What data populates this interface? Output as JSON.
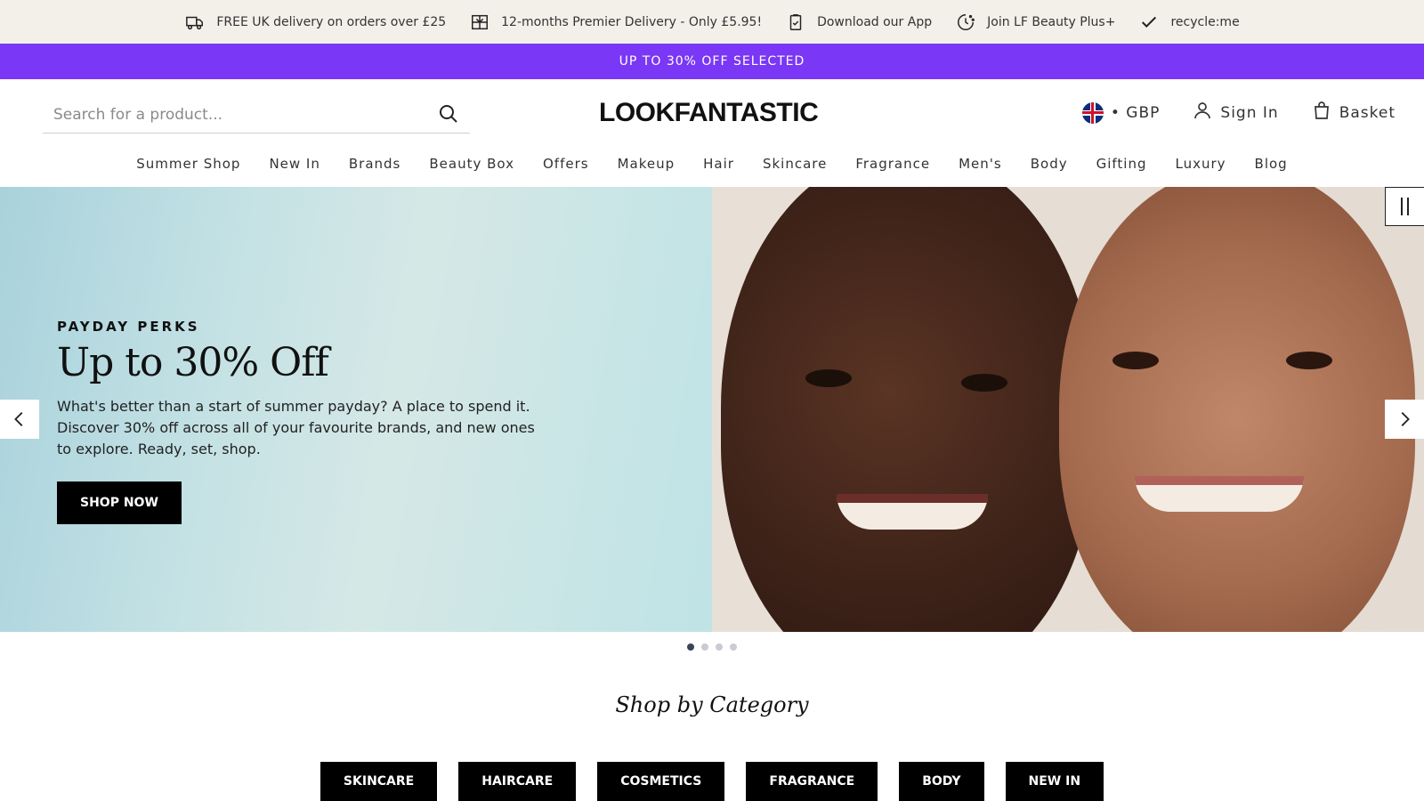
{
  "benefits": [
    {
      "label": "FREE UK delivery on orders over £25",
      "icon": "truck-icon"
    },
    {
      "label": "12-months Premier Delivery - Only £5.95!",
      "icon": "gift-icon"
    },
    {
      "label": "Download our App",
      "icon": "phone-icon"
    },
    {
      "label": "Join LF Beauty Plus+",
      "icon": "loyalty-icon"
    },
    {
      "label": "recycle:me",
      "icon": "check-icon"
    }
  ],
  "promo": {
    "text": "UP TO 30% OFF SELECTED",
    "color": "#7a37f5"
  },
  "search": {
    "placeholder": "Search for a product..."
  },
  "logo": "LOOKFANTASTIC",
  "header": {
    "currency": "• GBP",
    "sign_in": "Sign In",
    "basket": "Basket"
  },
  "nav": [
    "Summer Shop",
    "New In",
    "Brands",
    "Beauty Box",
    "Offers",
    "Makeup",
    "Hair",
    "Skincare",
    "Fragrance",
    "Men's",
    "Body",
    "Gifting",
    "Luxury",
    "Blog"
  ],
  "hero": {
    "eyebrow": "PAYDAY PERKS",
    "title": "Up to 30% Off",
    "body": "What's better than a start of summer payday? A place to spend it. Discover 30% off across all of your favourite brands, and new ones to explore. Ready, set, shop.",
    "cta": "SHOP NOW",
    "slide_count": 4,
    "active_slide": 1
  },
  "category_section": {
    "title": "Shop by Category",
    "items": [
      "SKINCARE",
      "HAIRCARE",
      "COSMETICS",
      "FRAGRANCE",
      "BODY",
      "NEW IN"
    ]
  }
}
